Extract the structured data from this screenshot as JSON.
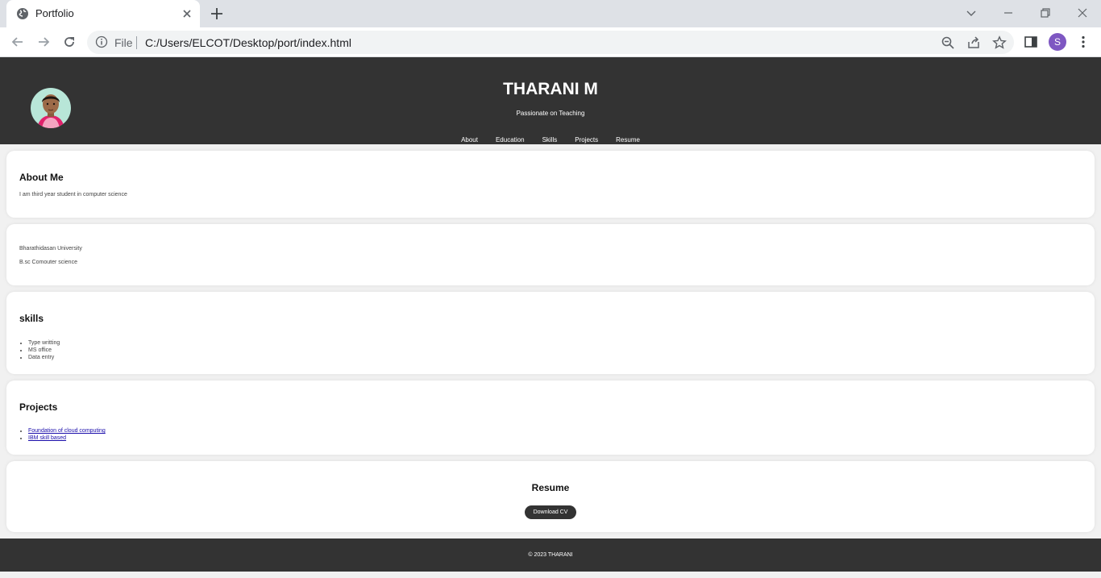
{
  "browser": {
    "tab_title": "Portfolio",
    "url_scheme": "File",
    "url": "C:/Users/ELCOT/Desktop/port/index.html",
    "profile_initial": "S"
  },
  "header": {
    "name": "THARANI M",
    "tagline": "Passionate on Teaching",
    "nav": [
      "About",
      "Education",
      "Skills",
      "Projects",
      "Resume"
    ]
  },
  "about": {
    "title": "About Me",
    "text": "I am third year student in computer science"
  },
  "education": {
    "lines": [
      "Bharathidasan University",
      "B.sc Comouter science"
    ]
  },
  "skills": {
    "title": "skills",
    "items": [
      "Type writting",
      "MS office",
      "Data entry"
    ]
  },
  "projects": {
    "title": "Projects",
    "items": [
      "Foundation of cloud computing",
      "IBM skill based"
    ]
  },
  "resume": {
    "title": "Resume",
    "button": "Download CV"
  },
  "footer": {
    "text": "© 2023 THARANI"
  },
  "colors": {
    "header_bg": "#333333",
    "page_bg": "#f1f1f1",
    "link": "#1a0dab",
    "avatar": "#7e57c2"
  }
}
